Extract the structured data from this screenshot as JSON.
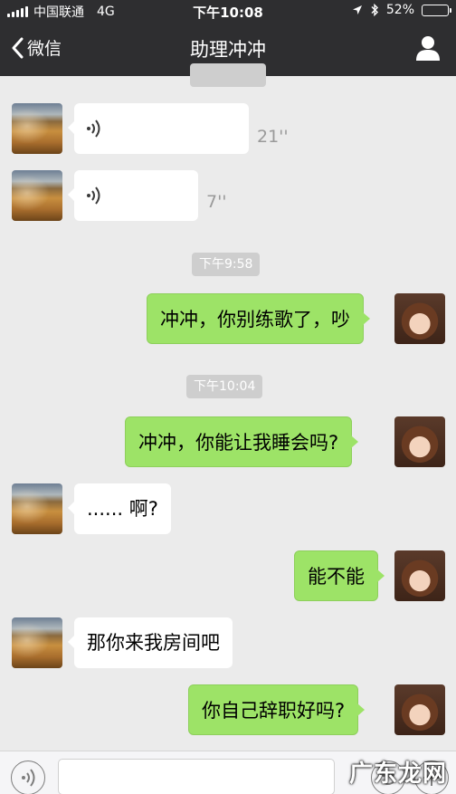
{
  "status_bar": {
    "carrier": "中国联通",
    "network": "4G",
    "time": "下午10:08",
    "battery": "52%",
    "battery_level": 0.52
  },
  "nav": {
    "back_label": "微信",
    "title": "助理冲冲"
  },
  "messages": {
    "voice_1_duration": "21''",
    "voice_2_duration": "7''",
    "stamp_1": "下午9:58",
    "out_1": "冲冲，你别练歌了，吵",
    "stamp_2": "下午10:04",
    "out_2": "冲冲，你能让我睡会吗?",
    "in_1": "...... 啊?",
    "out_3": "能不能",
    "in_2": "那你来我房间吧",
    "out_4": "你自己辞职好吗?"
  },
  "watermark": "广东龙网",
  "icons": {
    "back": "chevron-left-icon",
    "profile": "person-icon",
    "voice": "voice-wave-icon",
    "mic": "voice-input-icon",
    "emoji": "emoji-icon",
    "plus": "plus-icon"
  },
  "colors": {
    "nav_bg": "#2e2e30",
    "chat_bg": "#ebebeb",
    "bubble_out": "#9de367",
    "bubble_in": "#ffffff"
  }
}
